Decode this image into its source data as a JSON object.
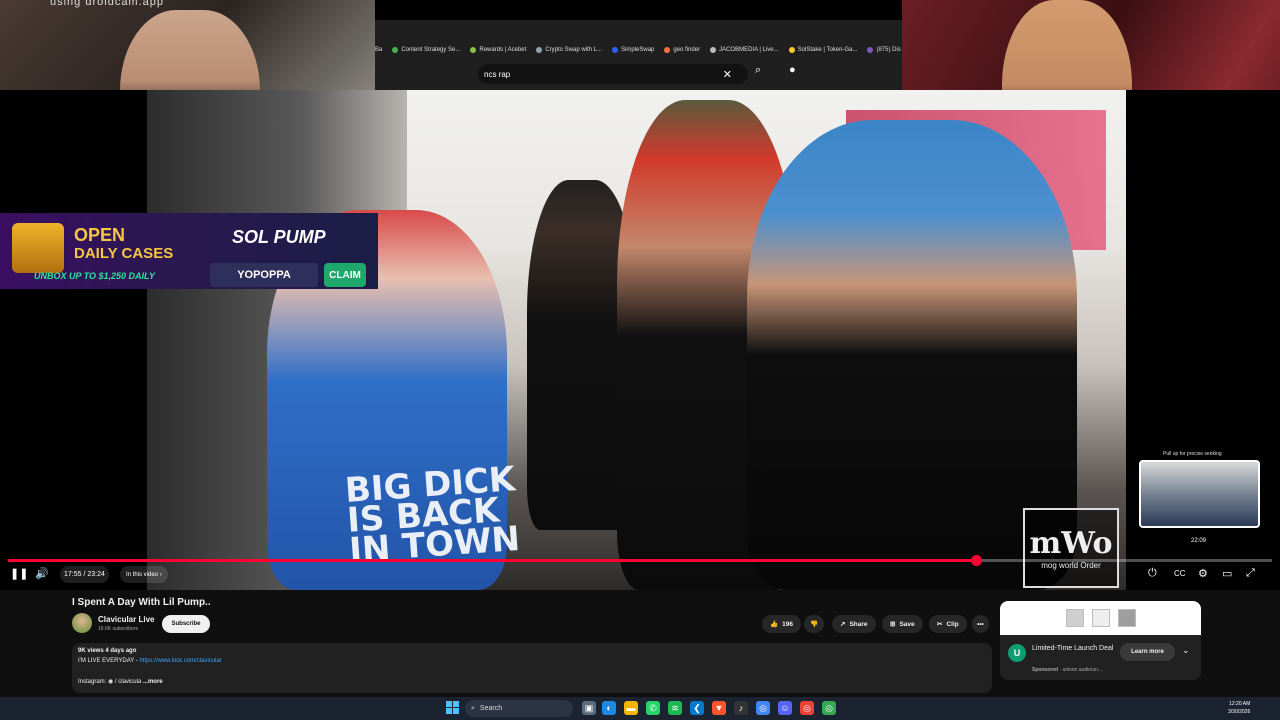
{
  "overlay": {
    "cam_watermark": "using droidcam.app"
  },
  "browser": {
    "bookmarks": [
      {
        "label": "Ba"
      },
      {
        "label": "Content Strategy Se..."
      },
      {
        "label": "Rewards | Acebet"
      },
      {
        "label": "Crypto Swap with L..."
      },
      {
        "label": "SimpleSwap"
      },
      {
        "label": "geo finder"
      },
      {
        "label": "JACOBMEDIA | Live..."
      },
      {
        "label": "SolStake | Token-Ga..."
      },
      {
        "label": "(875) Dis"
      }
    ],
    "search_query": "ncs rap",
    "icons": {
      "clear": "close-icon",
      "search": "search-icon",
      "voice": "mic-icon"
    }
  },
  "ad": {
    "line1": "OPEN",
    "line2": "DAILY CASES",
    "tagline": "UNBOX UP TO $1,250 DAILY",
    "brand": "SOL PUMP",
    "code": "YOPOPPA",
    "claim": "CLAIM"
  },
  "video_overlay": {
    "shirt_text_1": "BIG DICK",
    "shirt_text_2": "IS BACK",
    "shirt_text_3": "IN TOWN",
    "watermark_mark": "mWo",
    "watermark_sub": "mog world Order"
  },
  "player": {
    "seek_hint": "Pull up for precise seeking",
    "hover_time": "22:09",
    "time_display": "17:55 / 23:24",
    "chapter_label": "In this video",
    "progress_played": 0.766,
    "progress_hover": 0.946,
    "colors": {
      "progress": "#ff0033"
    }
  },
  "video_info": {
    "title": "I Spent A Day With Lil Pump..",
    "channel_name": "Clavicular Live",
    "subscribers": "16.6K subscribers",
    "subscribe_label": "Subscribe",
    "likes": "196",
    "share_label": "Share",
    "save_label": "Save",
    "clip_label": "Clip",
    "more_label": "•••",
    "views_meta": "9K views  4 days ago",
    "desc_line": "I'M LIVE EVERYDAY - ",
    "desc_link": "https://www.kick.com/clavicular",
    "insta_prefix": "Instagram: ",
    "insta_handle": " / clavicula",
    "more_link": "...more"
  },
  "sponsored": {
    "title": "Limited-Time Launch Deal",
    "sponsored_label": "Sponsored",
    "domain": "unison.audio/un...",
    "button": "Learn more",
    "logo_letter": "U"
  },
  "taskbar": {
    "search_label": "Search",
    "time": "12:20 AM",
    "date": "3/30/2026"
  }
}
